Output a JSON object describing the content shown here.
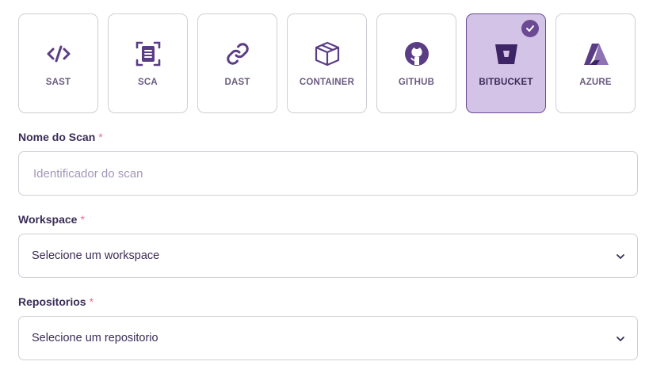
{
  "scan_types": [
    {
      "label": "SAST",
      "icon": "code-icon",
      "selected": false
    },
    {
      "label": "SCA",
      "icon": "document-scan-icon",
      "selected": false
    },
    {
      "label": "DAST",
      "icon": "link-icon",
      "selected": false
    },
    {
      "label": "CONTAINER",
      "icon": "box-icon",
      "selected": false
    },
    {
      "label": "GITHUB",
      "icon": "github-icon",
      "selected": false
    },
    {
      "label": "BITBUCKET",
      "icon": "bitbucket-icon",
      "selected": true
    },
    {
      "label": "AZURE",
      "icon": "azure-icon",
      "selected": false
    }
  ],
  "form": {
    "scan_name": {
      "label": "Nome do Scan",
      "required_mark": "*",
      "placeholder": "Identificador do scan",
      "value": ""
    },
    "workspace": {
      "label": "Workspace",
      "required_mark": "*",
      "value": "Selecione um workspace"
    },
    "repositories": {
      "label": "Repositorios",
      "required_mark": "*",
      "value": "Selecione um repositorio"
    }
  },
  "colors": {
    "accent": "#6b4a93",
    "selected_bg": "#d3c3e6",
    "label": "#3a2d57",
    "required": "#f06a8c",
    "border": "#cfcfd6"
  }
}
